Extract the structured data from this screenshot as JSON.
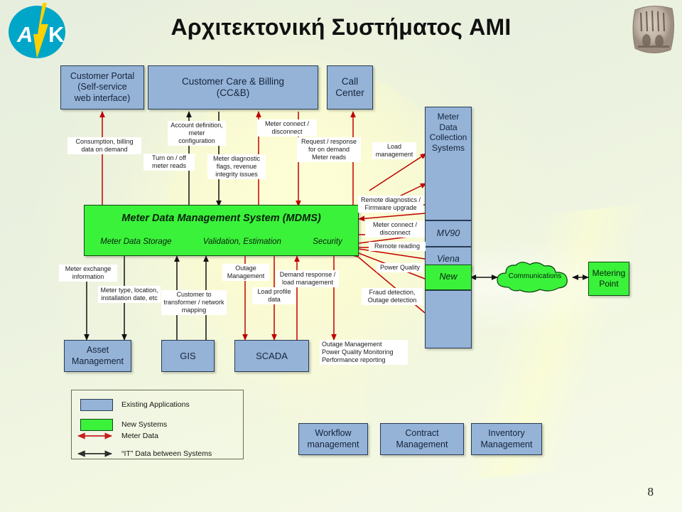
{
  "slide": {
    "title": "Αρχιτεκτονική Συστήματος AMI",
    "page_number": "8",
    "logo_text": "ΑΗΚ",
    "logo_alt": "ahk-utility-logo",
    "coin_alt": "ancient-stone-relief-image"
  },
  "colors": {
    "existing_applications": "#95b3d7",
    "new_systems": "#3bf23b",
    "meter_data_arrow": "#c00000",
    "it_data_arrow": "#000000",
    "box_border": "#2a3b55",
    "background": "#eef3e3"
  },
  "top_boxes": [
    {
      "id": "customer-portal",
      "label": "Customer Portal\n(Self-service\nweb interface)",
      "lines": [
        "Customer Portal",
        "(Self-service",
        "web interface)"
      ],
      "type": "existing"
    },
    {
      "id": "customer-care-billing",
      "label": "Customer Care & Billing (CC&B)",
      "lines": [
        "Customer Care & Billing",
        "(CC&B)"
      ],
      "type": "existing"
    },
    {
      "id": "call-center",
      "label": "Call Center",
      "lines": [
        "Call",
        "Center"
      ],
      "type": "existing"
    }
  ],
  "collection_stack": {
    "title_lines": [
      "Meter Data",
      "Collection",
      "Systems"
    ],
    "title": "Meter Data Collection Systems",
    "segments": [
      {
        "id": "mv90",
        "label": "MV90",
        "type": "existing"
      },
      {
        "id": "viena",
        "label": "Viena",
        "type": "existing"
      },
      {
        "id": "new",
        "label": "New",
        "type": "new"
      },
      {
        "id": "blank-segment",
        "label": "",
        "type": "existing"
      }
    ]
  },
  "mdms": {
    "title": "Meter Data Management System (MDMS)",
    "functions": [
      "Meter Data Storage",
      "Validation, Estimation",
      "Security"
    ]
  },
  "lower_boxes": [
    {
      "id": "asset-management",
      "lines": [
        "Asset",
        "Management"
      ],
      "label": "Asset Management",
      "type": "existing"
    },
    {
      "id": "gis",
      "lines": [
        "GIS"
      ],
      "label": "GIS",
      "type": "existing"
    },
    {
      "id": "scada",
      "lines": [
        "SCADA"
      ],
      "label": "SCADA",
      "type": "existing"
    },
    {
      "id": "workflow-management",
      "lines": [
        "Workflow",
        "management"
      ],
      "label": "Workflow management",
      "type": "existing"
    },
    {
      "id": "contract-management",
      "lines": [
        "Contract",
        "Management"
      ],
      "label": "Contract Management",
      "type": "existing"
    },
    {
      "id": "inventory-management",
      "lines": [
        "Inventory",
        "Management"
      ],
      "label": "Inventory Management",
      "type": "existing"
    }
  ],
  "right_nodes": [
    {
      "id": "communications",
      "label": "Communications",
      "type": "new"
    },
    {
      "id": "metering-point",
      "lines": [
        "Metering",
        "Point"
      ],
      "label": "Metering Point",
      "type": "new"
    }
  ],
  "flow_labels": [
    {
      "id": "consumption-billing",
      "text": "Consumption, billing data on demand"
    },
    {
      "id": "turn-on-off-meter-reads",
      "text": "Turn on / off meter reads"
    },
    {
      "id": "account-definition",
      "text": "Account definition, meter configuration"
    },
    {
      "id": "meter-diagnostic-flags",
      "text": "Meter diagnostic flags, revenue integrity issues"
    },
    {
      "id": "meter-connect-disconnect-top",
      "text": "Meter connect / disconnect"
    },
    {
      "id": "request-response-on-demand",
      "text": "Request / response for on demand Meter reads"
    },
    {
      "id": "load-management",
      "text": "Load management"
    },
    {
      "id": "remote-diagnostics-firmware",
      "text": "Remote diagnostics / Firmware upgrade"
    },
    {
      "id": "meter-connect-disconnect-right",
      "text": "Meter connect / disconnect"
    },
    {
      "id": "remote-reading",
      "text": "Remote reading"
    },
    {
      "id": "power-quality",
      "text": "Power Quality"
    },
    {
      "id": "fraud-outage-detection",
      "text": "Fraud detection, Outage detection"
    },
    {
      "id": "meter-exchange-information",
      "text": "Meter exchange information"
    },
    {
      "id": "meter-type-location",
      "text": "Meter type, location, installation date, etc"
    },
    {
      "id": "customer-to-transformer",
      "text": "Customer to transformer / network mapping"
    },
    {
      "id": "outage-management",
      "text": "Outage Management"
    },
    {
      "id": "load-profile-data",
      "text": "Load profile data"
    },
    {
      "id": "demand-response-load-mgmt",
      "text": "Demand response / load management"
    },
    {
      "id": "scada-functions",
      "text": "Outage Management\nPower Quality Monitoring\nPerformance reporting"
    }
  ],
  "flow_label_text": {
    "consumption_billing": [
      "Consumption, billing",
      "data on demand"
    ],
    "turn_on_off": [
      "Turn on / off",
      "meter reads"
    ],
    "account_definition": [
      "Account definition,",
      "meter",
      "configuration"
    ],
    "meter_diagnostic": [
      "Meter diagnostic",
      "flags, revenue",
      "integrity issues"
    ],
    "meter_connect_top": [
      "Meter connect /",
      "disconnect"
    ],
    "request_response": [
      "Request / response",
      "for on demand",
      "Meter reads"
    ],
    "load_management": [
      "Load",
      "management"
    ],
    "remote_diagnostics": [
      "Remote diagnostics /",
      "Firmware upgrade"
    ],
    "meter_connect_right": [
      "Meter connect /",
      "disconnect"
    ],
    "remote_reading": [
      "Remote reading"
    ],
    "power_quality": [
      "Power Quality"
    ],
    "fraud_outage": [
      "Fraud detection,",
      "Outage detection"
    ],
    "meter_exchange": [
      "Meter exchange",
      "information"
    ],
    "meter_type_location": [
      "Meter type, location,",
      "installation date, etc"
    ],
    "customer_transformer": [
      "Customer to",
      "transformer / network",
      "mapping"
    ],
    "outage_management": [
      "Outage",
      "Management"
    ],
    "load_profile": [
      "Load profile",
      "data"
    ],
    "demand_response": [
      "Demand response /",
      "load management"
    ],
    "scada_functions": [
      "Outage Management",
      "Power Quality Monitoring",
      "Performance reporting"
    ]
  },
  "legend": {
    "items": [
      {
        "id": "legend-existing",
        "label": "Existing Applications",
        "kind": "swatch-blue"
      },
      {
        "id": "legend-new",
        "label": "New Systems",
        "kind": "swatch-green"
      },
      {
        "id": "legend-meter-data",
        "label": "Meter Data",
        "kind": "arrow-red"
      },
      {
        "id": "legend-it-data",
        "label": "“IT” Data between Systems",
        "kind": "arrow-black"
      }
    ]
  }
}
